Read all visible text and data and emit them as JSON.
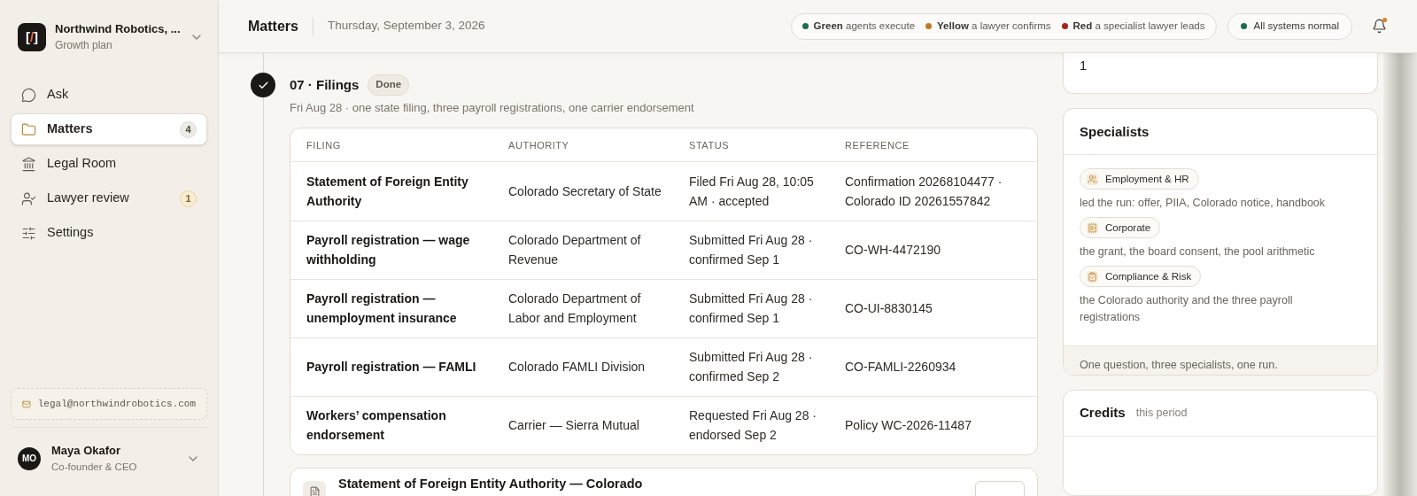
{
  "sidebar": {
    "org": {
      "logo": "[/]",
      "name": "Northwind Robotics, ...",
      "plan": "Growth plan"
    },
    "nav": [
      {
        "label": "Ask",
        "selected": false
      },
      {
        "label": "Matters",
        "selected": true,
        "badge": "4",
        "badge_highlight": false
      },
      {
        "label": "Legal Room",
        "selected": false
      },
      {
        "label": "Lawyer review",
        "selected": false,
        "badge": "1",
        "badge_highlight": true
      },
      {
        "label": "Settings",
        "selected": false
      }
    ],
    "email": "legal@northwindrobotics.com",
    "user": {
      "initials": "MO",
      "name": "Maya Okafor",
      "role": "Co-founder & CEO"
    }
  },
  "header": {
    "title": "Matters",
    "date": "Thursday, September 3, 2026",
    "legend": [
      {
        "color": "#1f6b4f",
        "label": "Green",
        "text": "agents execute"
      },
      {
        "color": "#c07a22",
        "label": "Yellow",
        "text": "a lawyer confirms"
      },
      {
        "color": "#a4251c",
        "label": "Red",
        "text": "a specialist lawyer leads"
      }
    ],
    "status": {
      "color": "#1f6b4f",
      "label": "All systems normal"
    },
    "notifications": {
      "unread": true
    }
  },
  "step": {
    "title": "07 · Filings",
    "badge": "Done",
    "done": true,
    "subtitle": "Fri Aug 28 · one state filing, three payroll registrations, one carrier endorsement"
  },
  "table": {
    "columns": [
      "FILING",
      "AUTHORITY",
      "STATUS",
      "REFERENCE"
    ],
    "rows": [
      [
        "Statement of Foreign Entity Authority",
        "Colorado Secretary of State",
        "Filed Fri Aug 28, 10:05 AM · accepted",
        "Confirmation 20268104477 · Colorado ID 20261557842"
      ],
      [
        "Payroll registration — wage withholding",
        "Colorado Department of Revenue",
        "Submitted Fri Aug 28 · confirmed Sep 1",
        "CO-WH-4472190"
      ],
      [
        "Payroll registration — unemployment insurance",
        "Colorado Department of Labor and Employment",
        "Submitted Fri Aug 28 · confirmed Sep 1",
        "CO-UI-8830145"
      ],
      [
        "Payroll registration — FAMLI",
        "Colorado FAMLI Division",
        "Submitted Fri Aug 28 · confirmed Sep 2",
        "CO-FAMLI-2260934"
      ],
      [
        "Workers’ compensation endorsement",
        "Carrier — Sierra Mutual",
        "Requested Fri Aug 28 · endorsed Sep 2",
        "Policy WC-2026-11487"
      ]
    ]
  },
  "document_card": {
    "title": "Statement of Foreign Entity Authority — Colorado"
  },
  "side_panel": {
    "top_card_value": "1",
    "specialists": {
      "title": "Specialists",
      "items": [
        {
          "label": "Employment & HR",
          "note": "led the run: offer, PIIA, Colorado notice, handbook"
        },
        {
          "label": "Corporate",
          "note": "the grant, the board consent, the pool arithmetic"
        },
        {
          "label": "Compliance & Risk",
          "note": "the Colorado authority and the three payroll registrations"
        }
      ],
      "footer": "One question, three specialists, one run."
    },
    "credits": {
      "title": "Credits",
      "subtitle": "this period"
    }
  }
}
